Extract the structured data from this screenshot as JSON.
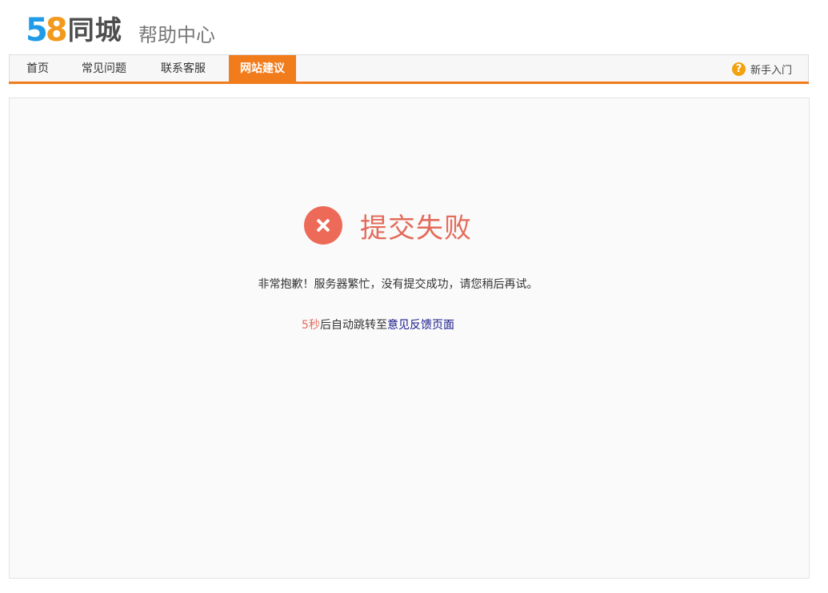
{
  "header": {
    "logo_digit_5": "5",
    "logo_digit_8": "8",
    "logo_text": "同城",
    "site_subtitle": "帮助中心"
  },
  "nav": {
    "items": [
      {
        "label": "首页"
      },
      {
        "label": "常见问题"
      },
      {
        "label": "联系客服"
      },
      {
        "label": "网站建议",
        "active": true
      }
    ],
    "help_label": "新手入门",
    "help_icon_glyph": "?"
  },
  "result": {
    "title": "提交失败",
    "message": "非常抱歉！服务器繁忙，没有提交成功，请您稍后再试。",
    "countdown": "5秒",
    "redirect_text": "后自动跳转至",
    "redirect_link": "意见反馈页面"
  },
  "colors": {
    "accent": "#f07c1c",
    "error": "#ec6a57",
    "link": "#1a1a8c"
  }
}
